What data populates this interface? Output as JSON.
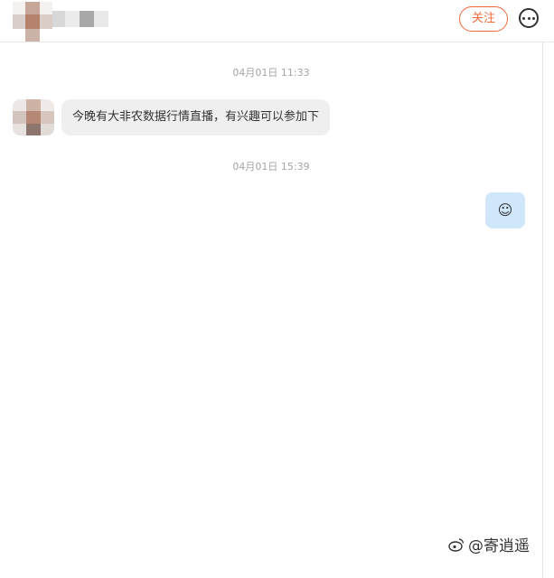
{
  "header": {
    "follow_label": "关注",
    "more_icon": "more-horizontal-circle-icon"
  },
  "messages": [
    {
      "timestamp": "04月01日 11:33",
      "direction": "received",
      "text": "今晚有大非农数据行情直播，有兴趣可以参加下"
    },
    {
      "timestamp": "04月01日 15:39",
      "direction": "sent",
      "text": "☺"
    }
  ],
  "watermark": {
    "text": "@寄逍遥"
  },
  "colors": {
    "accent": "#f06a3c",
    "received_bubble": "#efefef",
    "sent_bubble": "#cfe6fb",
    "timestamp": "#a5a5a5"
  }
}
